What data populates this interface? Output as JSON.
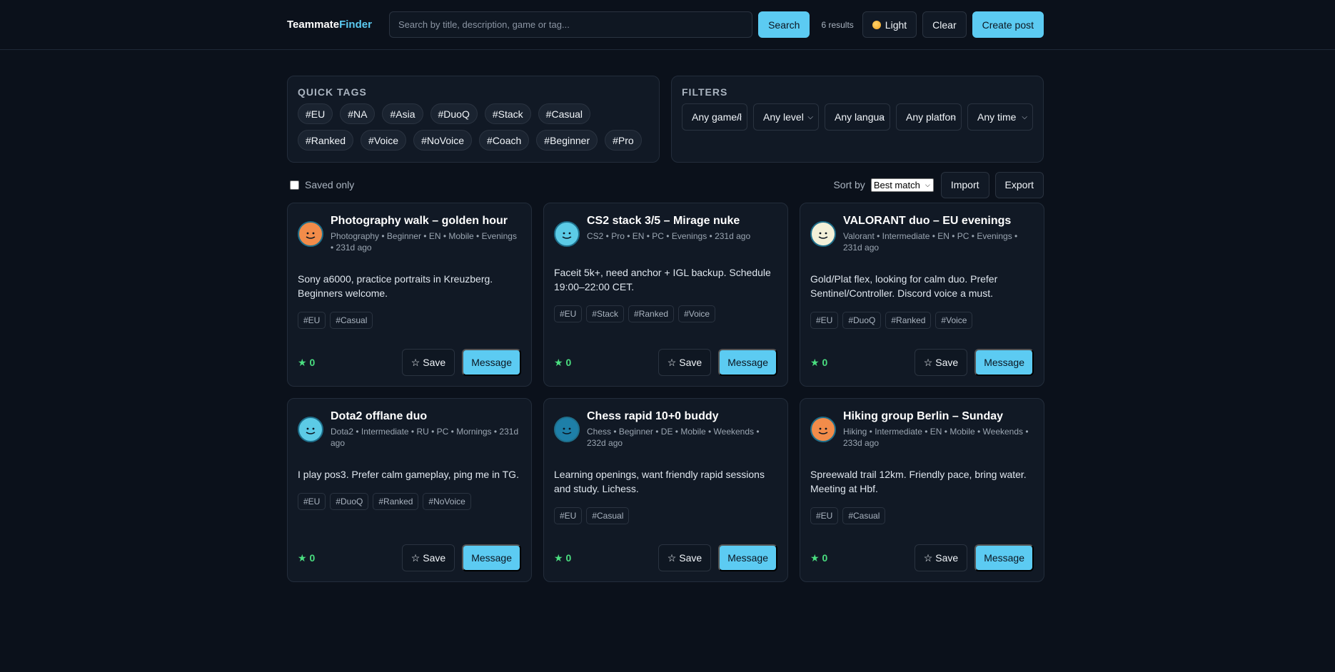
{
  "header": {
    "logo_part1": "Teammate",
    "logo_part2": "Finder",
    "search_placeholder": "Search by title, description, game or tag...",
    "search_button": "Search",
    "results": "6 results",
    "theme_button": "Light",
    "clear_button": "Clear",
    "create_button": "Create post"
  },
  "quick_tags": {
    "title": "QUICK TAGS",
    "tags": [
      "#EU",
      "#NA",
      "#Asia",
      "#DuoQ",
      "#Stack",
      "#Casual",
      "#Ranked",
      "#Voice",
      "#NoVoice",
      "#Coach",
      "#Beginner",
      "#Pro"
    ]
  },
  "filters": {
    "title": "FILTERS",
    "selects": [
      "Any game/l",
      "Any level",
      "Any langua",
      "Any platfon",
      "Any time"
    ]
  },
  "controls": {
    "saved_only": "Saved only",
    "sort_label": "Sort by",
    "sort_value": "Best match",
    "import": "Import",
    "export": "Export"
  },
  "posts": [
    {
      "title": "Photography walk – golden hour",
      "meta": "Photography • Beginner • EN • Mobile • Evenings • 231d ago",
      "desc": "Sony a6000, practice portraits in Kreuzberg. Beginners welcome.",
      "tags": [
        "#EU",
        "#Casual"
      ],
      "stars": "★ 0",
      "avatar_color": "#f28c4a",
      "save": "Save",
      "message": "Message"
    },
    {
      "title": "CS2 stack 3/5 – Mirage nuke",
      "meta": "CS2 • Pro • EN • PC • Evenings • 231d ago",
      "desc": "Faceit 5k+, need anchor + IGL backup. Schedule 19:00–22:00 CET.",
      "tags": [
        "#EU",
        "#Stack",
        "#Ranked",
        "#Voice"
      ],
      "stars": "★ 0",
      "avatar_color": "#5ccbe6",
      "save": "Save",
      "message": "Message"
    },
    {
      "title": "VALORANT duo – EU evenings",
      "meta": "Valorant • Intermediate • EN • PC • Evenings • 231d ago",
      "desc": "Gold/Plat flex, looking for calm duo. Prefer Sentinel/Controller. Discord voice a must.",
      "tags": [
        "#EU",
        "#DuoQ",
        "#Ranked",
        "#Voice"
      ],
      "stars": "★ 0",
      "avatar_color": "#f3f0d8",
      "save": "Save",
      "message": "Message"
    },
    {
      "title": "Dota2 offlane duo",
      "meta": "Dota2 • Intermediate • RU • PC • Mornings • 231d ago",
      "desc": "I play pos3. Prefer calm gameplay, ping me in TG.",
      "tags": [
        "#EU",
        "#DuoQ",
        "#Ranked",
        "#NoVoice"
      ],
      "stars": "★ 0",
      "avatar_color": "#5ccbe6",
      "save": "Save",
      "message": "Message"
    },
    {
      "title": "Chess rapid 10+0 buddy",
      "meta": "Chess • Beginner • DE • Mobile • Weekends • 232d ago",
      "desc": "Learning openings, want friendly rapid sessions and study. Lichess.",
      "tags": [
        "#EU",
        "#Casual"
      ],
      "stars": "★ 0",
      "avatar_color": "#1e7fa8",
      "save": "Save",
      "message": "Message"
    },
    {
      "title": "Hiking group Berlin – Sunday",
      "meta": "Hiking • Intermediate • EN • Mobile • Weekends • 233d ago",
      "desc": "Spreewald trail 12km. Friendly pace, bring water. Meeting at Hbf.",
      "tags": [
        "#EU",
        "#Casual"
      ],
      "stars": "★ 0",
      "avatar_color": "#f28c4a",
      "save": "Save",
      "message": "Message"
    }
  ]
}
